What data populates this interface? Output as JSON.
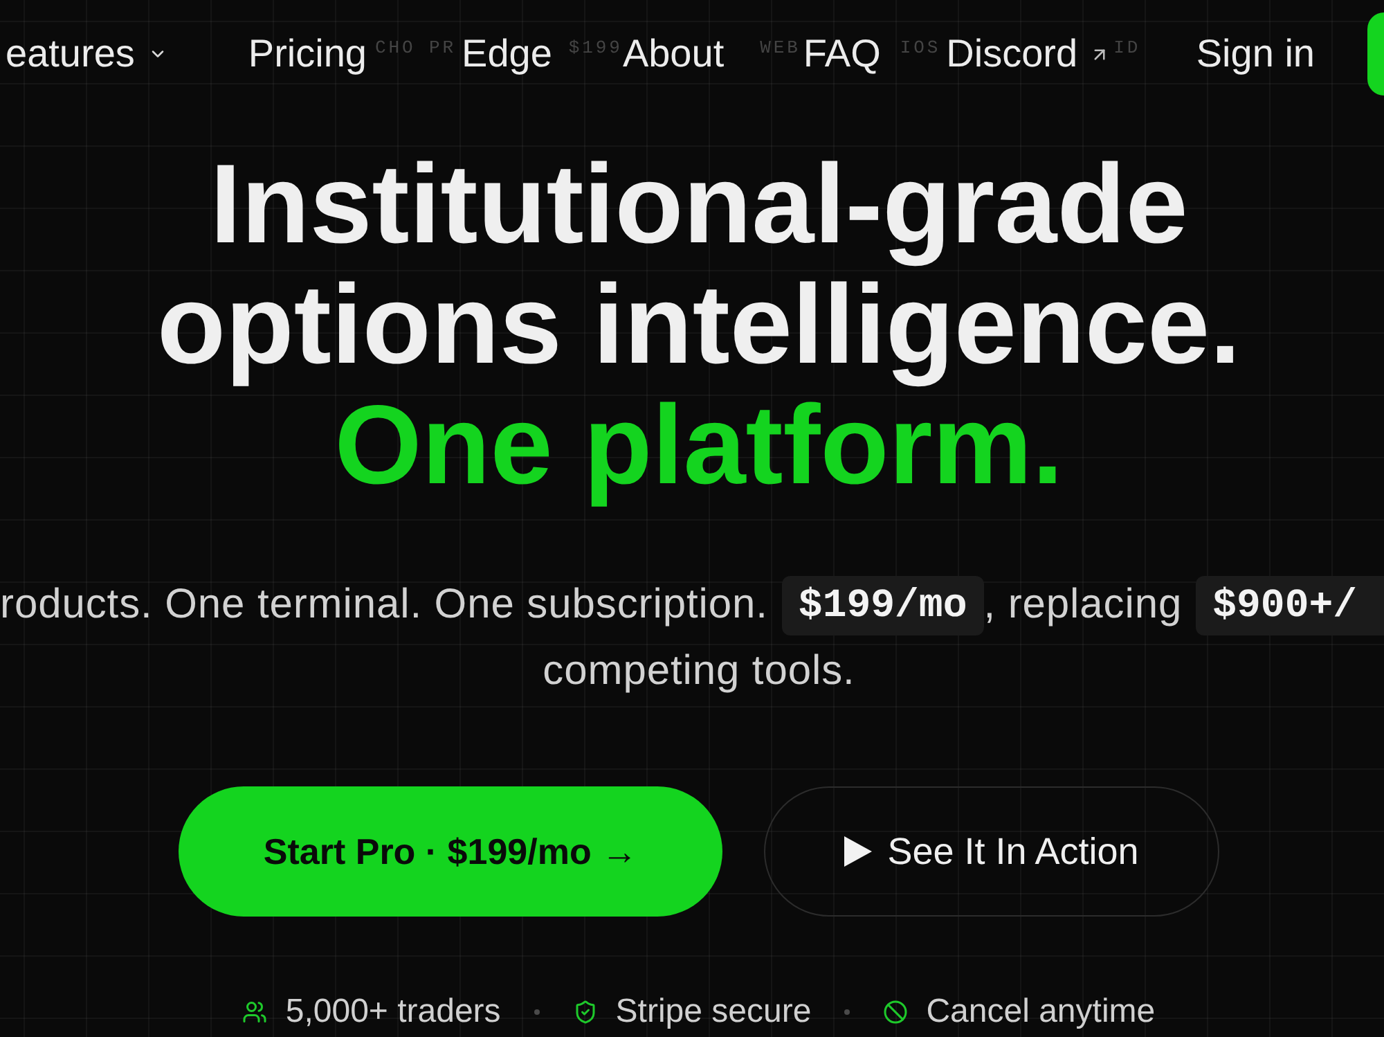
{
  "nav": {
    "items": [
      {
        "label": "eatures",
        "kind": "dropdown"
      },
      {
        "label": "Pricing",
        "kind": "link"
      },
      {
        "label": "Edge",
        "kind": "link"
      },
      {
        "label": "About",
        "kind": "link"
      },
      {
        "label": "FAQ",
        "kind": "link"
      },
      {
        "label": "Discord",
        "kind": "external"
      }
    ],
    "ticker": [
      "CHO PR",
      "$199",
      "WEB",
      "IOS",
      "ID"
    ],
    "sign_in": "Sign in"
  },
  "headline": {
    "lines": [
      {
        "text": "Institutional-grade",
        "accent": false
      },
      {
        "text": "options intelligence.",
        "accent": false
      },
      {
        "text": "One platform.",
        "accent": true
      }
    ]
  },
  "subtitle": {
    "lines": [
      [
        {
          "kind": "text",
          "text": "roducts. One terminal. One subscription."
        },
        {
          "kind": "code",
          "text": "$199/mo"
        },
        {
          "kind": "text",
          "text": ", replacing"
        },
        {
          "kind": "code",
          "text": "$900+/"
        }
      ],
      [
        {
          "kind": "text",
          "text": "competing tools."
        }
      ]
    ]
  },
  "actions": [
    {
      "label": "Start Pro · $199/mo →",
      "kind": "primary"
    },
    {
      "label": "See It In Action",
      "kind": "video"
    }
  ],
  "trust": [
    "5,000+ traders",
    "Stripe secure",
    "Cancel anytime"
  ]
}
